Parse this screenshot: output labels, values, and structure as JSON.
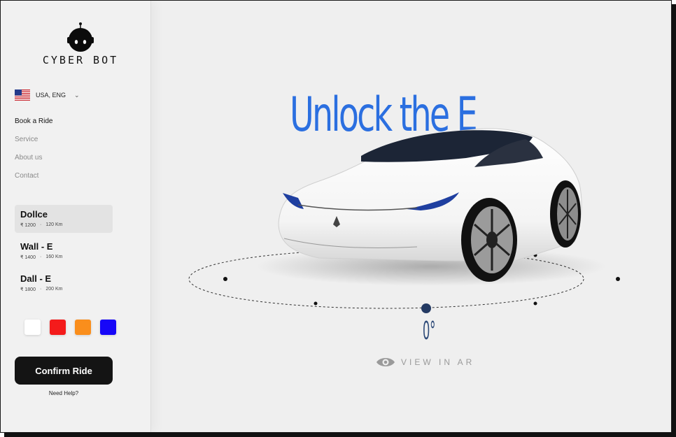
{
  "brand": {
    "name": "CYBER BOT",
    "icon": "robot-head-icon"
  },
  "locale": {
    "label": "USA, ENG",
    "flag": "us-flag-icon"
  },
  "nav": {
    "items": [
      {
        "label": "Book a Ride",
        "active": true
      },
      {
        "label": "Service",
        "active": false
      },
      {
        "label": "About us",
        "active": false
      },
      {
        "label": "Contact",
        "active": false
      }
    ]
  },
  "rides": [
    {
      "name": "Dollce",
      "price": "₹ 1200",
      "distance": "120 Km",
      "selected": true
    },
    {
      "name": "Wall - E",
      "price": "₹ 1400",
      "distance": "160 Km",
      "selected": false
    },
    {
      "name": "Dall - E",
      "price": "₹ 1800",
      "distance": "200 Km",
      "selected": false
    }
  ],
  "color_options": [
    "#ffffff",
    "#f41b1b",
    "#fa8e1c",
    "#1707f8"
  ],
  "actions": {
    "confirm_label": "Confirm Ride",
    "help_label": "Need Help?"
  },
  "hero": {
    "headline": "Unlock the Extraordinary",
    "rotation_label": "0°",
    "ar_label": "VIEW IN AR",
    "accent": "#2b6fe0"
  }
}
